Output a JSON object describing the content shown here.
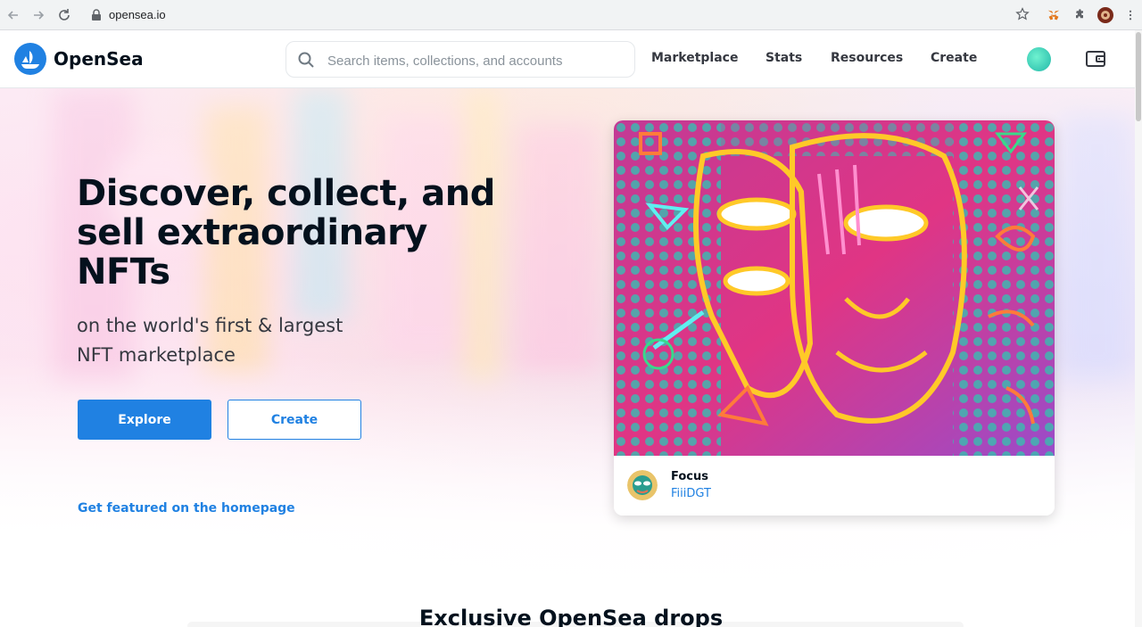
{
  "browser": {
    "url": "opensea.io",
    "icons": [
      "back-arrow-icon",
      "forward-arrow-icon",
      "reload-icon",
      "lock-icon",
      "star-icon",
      "metamask-fox-icon",
      "puzzle-extensions-icon",
      "profile-icon",
      "more-vert-icon"
    ]
  },
  "header": {
    "brand": "OpenSea",
    "search_placeholder": "Search items, collections, and accounts",
    "nav": [
      "Marketplace",
      "Stats",
      "Resources",
      "Create"
    ]
  },
  "hero": {
    "headline": "Discover, collect, and sell extraordinary NFTs",
    "subtitle": "on the world's first & largest NFT marketplace",
    "explore_label": "Explore",
    "create_label": "Create",
    "featured_link": "Get featured on the homepage"
  },
  "card": {
    "title": "Focus",
    "creator": "FiiiDGT"
  },
  "section": {
    "drops_title": "Exclusive OpenSea drops"
  },
  "colors": {
    "accent": "#2081e2",
    "text_dark": "#04111d",
    "art_bg": "#d62f8f"
  }
}
